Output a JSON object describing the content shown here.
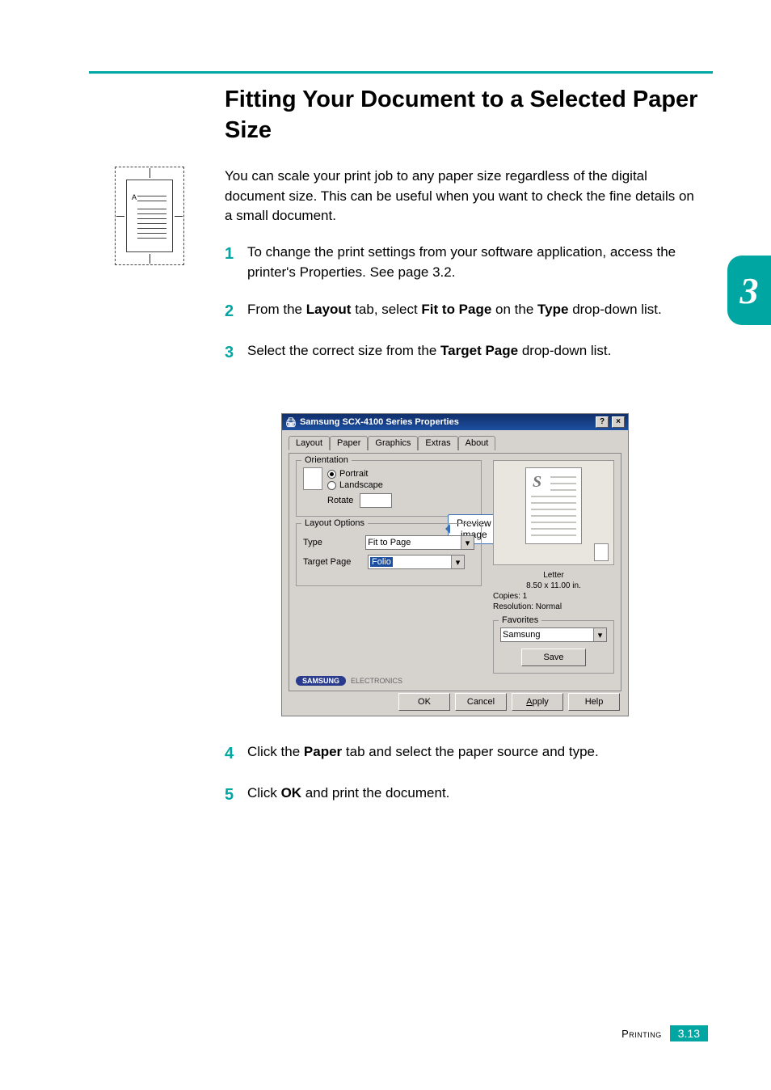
{
  "top_heading": "Fitting Your Document to a Selected Paper Size",
  "intro": "You can scale your print job to any paper size regardless of the digital document size. This can be useful when you want to check the fine details on a small document.",
  "diagram_letter": "A",
  "steps": {
    "s1": {
      "num": "1",
      "text_a": "To change the print settings from your software application, access the printer's Properties. See page 3.2."
    },
    "s2": {
      "num": "2",
      "text_a": "From the ",
      "b1": "Layout",
      "text_b": " tab, select ",
      "b2": "Fit to Page",
      "text_c": " on the ",
      "b3": "Type",
      "text_d": " drop-down list."
    },
    "s3": {
      "num": "3",
      "text_a": "Select the correct size from the ",
      "b1": "Target Page",
      "text_b": " drop-down list."
    },
    "s4": {
      "num": "4",
      "text_a": "Click the ",
      "b1": "Paper",
      "text_b": " tab and select the paper source and type."
    },
    "s5": {
      "num": "5",
      "text_a": "Click ",
      "b1": "OK",
      "text_b": " and print the document."
    }
  },
  "dialog": {
    "title": "Samsung SCX-4100 Series Properties",
    "winbtn_help": "?",
    "winbtn_close": "×",
    "tabs": {
      "layout": "Layout",
      "paper": "Paper",
      "graphics": "Graphics",
      "extras": "Extras",
      "about": "About"
    },
    "orientation": {
      "legend": "Orientation",
      "portrait": "Portrait",
      "landscape": "Landscape",
      "rotate": "Rotate"
    },
    "layout_options": {
      "legend": "Layout Options",
      "type_label": "Type",
      "type_value": "Fit to Page",
      "target_label": "Target Page",
      "target_value": "Folio"
    },
    "callout_line1": "Preview",
    "callout_line2": "image",
    "preview_s": "S",
    "preview_info": {
      "size_name": "Letter",
      "size_dim": "8.50 x 11.00 in.",
      "copies": "Copies: 1",
      "resolution": "Resolution: Normal"
    },
    "favorites": {
      "legend": "Favorites",
      "value": "Samsung",
      "save": "Save"
    },
    "logo_brand": "SAMSUNG",
    "logo_sub": "ELECTRONICS",
    "buttons": {
      "ok": "OK",
      "cancel": "Cancel",
      "apply": "Apply",
      "help": "Help",
      "apply_accel": "A"
    }
  },
  "side_tab": "3",
  "footer": {
    "label": "Printing",
    "page": "3.13"
  }
}
